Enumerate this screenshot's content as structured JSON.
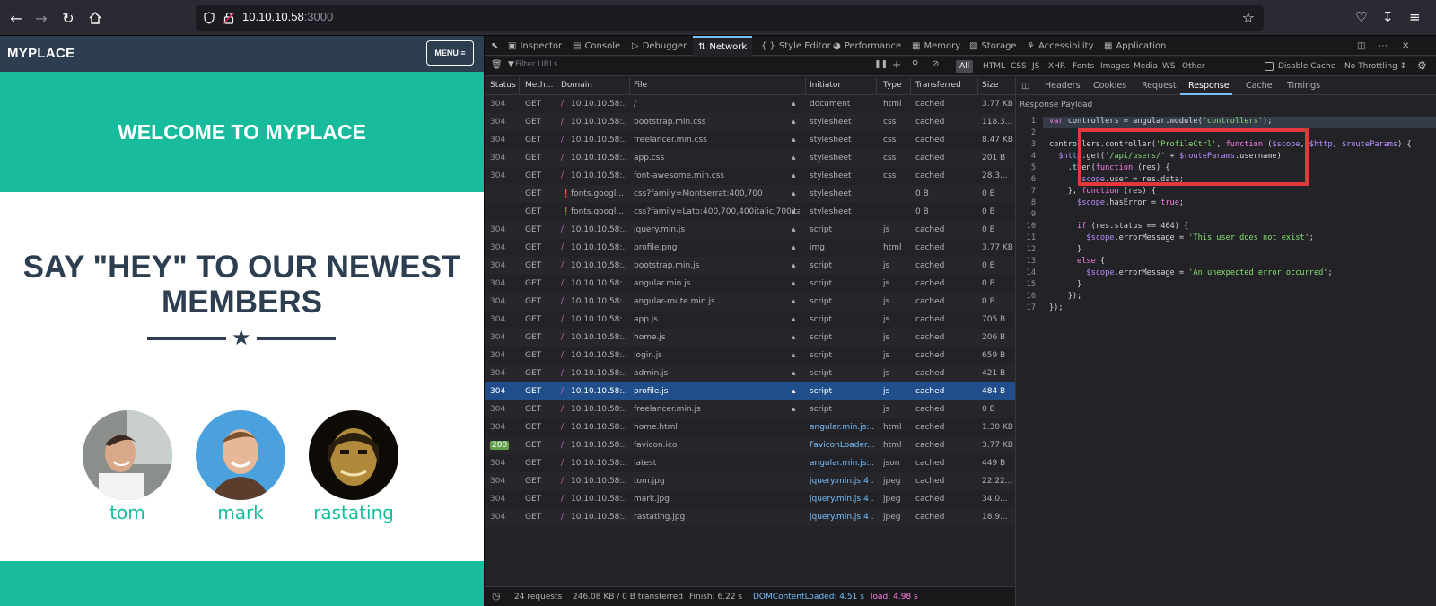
{
  "browser": {
    "url_host": "10.10.10.58",
    "url_port": ":3000"
  },
  "site": {
    "brand": "MYPLACE",
    "menu_label": "MENU ≡",
    "hero_title": "WELCOME TO MYPLACE",
    "members_title": "SAY \"HEY\" TO OUR NEWEST MEMBERS",
    "members": [
      {
        "name": "tom"
      },
      {
        "name": "mark"
      },
      {
        "name": "rastating"
      }
    ]
  },
  "devtools": {
    "tabs": [
      "Inspector",
      "Console",
      "Debugger",
      "Network",
      "Style Editor",
      "Performance",
      "Memory",
      "Storage",
      "Accessibility",
      "Application"
    ],
    "active_tab": "Network",
    "filter_placeholder": "Filter URLs",
    "type_filters": [
      "All",
      "HTML",
      "CSS",
      "JS",
      "XHR",
      "Fonts",
      "Images",
      "Media",
      "WS",
      "Other"
    ],
    "disable_cache": "Disable Cache",
    "throttling": "No Throttling ↕",
    "columns": [
      "Status",
      "Meth…",
      "Domain",
      "File",
      "Initiator",
      "Type",
      "Transferred",
      "Size"
    ],
    "rows": [
      {
        "status": "304",
        "method": "GET",
        "domain": "10.10.10.58:...",
        "file": "/",
        "initiator": "document",
        "type": "html",
        "transferred": "cached",
        "size": "3.77 KB"
      },
      {
        "status": "304",
        "method": "GET",
        "domain": "10.10.10.58:...",
        "file": "bootstrap.min.css",
        "initiator": "stylesheet",
        "type": "css",
        "transferred": "cached",
        "size": "118.3..."
      },
      {
        "status": "304",
        "method": "GET",
        "domain": "10.10.10.58:...",
        "file": "freelancer.min.css",
        "initiator": "stylesheet",
        "type": "css",
        "transferred": "cached",
        "size": "8.47 KB"
      },
      {
        "status": "304",
        "method": "GET",
        "domain": "10.10.10.58:...",
        "file": "app.css",
        "initiator": "stylesheet",
        "type": "css",
        "transferred": "cached",
        "size": "201 B"
      },
      {
        "status": "304",
        "method": "GET",
        "domain": "10.10.10.58:...",
        "file": "font-awesome.min.css",
        "initiator": "stylesheet",
        "type": "css",
        "transferred": "cached",
        "size": "28.3..."
      },
      {
        "status": "",
        "method": "GET",
        "domain": "fonts.googl...",
        "file": "css?family=Montserrat:400,700",
        "initiator": "stylesheet",
        "type": "",
        "transferred": "0 B",
        "size": "0 B"
      },
      {
        "status": "",
        "method": "GET",
        "domain": "fonts.googl...",
        "file": "css?family=Lato:400,700,400italic,700italic",
        "initiator": "stylesheet",
        "type": "",
        "transferred": "0 B",
        "size": "0 B"
      },
      {
        "status": "304",
        "method": "GET",
        "domain": "10.10.10.58:...",
        "file": "jquery.min.js",
        "initiator": "script",
        "type": "js",
        "transferred": "cached",
        "size": "0 B"
      },
      {
        "status": "304",
        "method": "GET",
        "domain": "10.10.10.58:...",
        "file": "profile.png",
        "initiator": "img",
        "type": "html",
        "transferred": "cached",
        "size": "3.77 KB"
      },
      {
        "status": "304",
        "method": "GET",
        "domain": "10.10.10.58:...",
        "file": "bootstrap.min.js",
        "initiator": "script",
        "type": "js",
        "transferred": "cached",
        "size": "0 B"
      },
      {
        "status": "304",
        "method": "GET",
        "domain": "10.10.10.58:...",
        "file": "angular.min.js",
        "initiator": "script",
        "type": "js",
        "transferred": "cached",
        "size": "0 B"
      },
      {
        "status": "304",
        "method": "GET",
        "domain": "10.10.10.58:...",
        "file": "angular-route.min.js",
        "initiator": "script",
        "type": "js",
        "transferred": "cached",
        "size": "0 B"
      },
      {
        "status": "304",
        "method": "GET",
        "domain": "10.10.10.58:...",
        "file": "app.js",
        "initiator": "script",
        "type": "js",
        "transferred": "cached",
        "size": "705 B"
      },
      {
        "status": "304",
        "method": "GET",
        "domain": "10.10.10.58:...",
        "file": "home.js",
        "initiator": "script",
        "type": "js",
        "transferred": "cached",
        "size": "206 B"
      },
      {
        "status": "304",
        "method": "GET",
        "domain": "10.10.10.58:...",
        "file": "login.js",
        "initiator": "script",
        "type": "js",
        "transferred": "cached",
        "size": "659 B"
      },
      {
        "status": "304",
        "method": "GET",
        "domain": "10.10.10.58:...",
        "file": "admin.js",
        "initiator": "script",
        "type": "js",
        "transferred": "cached",
        "size": "421 B"
      },
      {
        "status": "304",
        "method": "GET",
        "domain": "10.10.10.58:...",
        "file": "profile.js",
        "initiator": "script",
        "type": "js",
        "transferred": "cached",
        "size": "484 B"
      },
      {
        "status": "304",
        "method": "GET",
        "domain": "10.10.10.58:...",
        "file": "freelancer.min.js",
        "initiator": "script",
        "type": "js",
        "transferred": "cached",
        "size": "0 B"
      },
      {
        "status": "304",
        "method": "GET",
        "domain": "10.10.10.58:...",
        "file": "home.html",
        "initiator": "angular.min.js:...",
        "type": "html",
        "transferred": "cached",
        "size": "1.30 KB"
      },
      {
        "status": "200",
        "method": "GET",
        "domain": "10.10.10.58:...",
        "file": "favicon.ico",
        "initiator": "FaviconLoader....",
        "type": "html",
        "transferred": "cached",
        "size": "3.77 KB"
      },
      {
        "status": "304",
        "method": "GET",
        "domain": "10.10.10.58:...",
        "file": "latest",
        "initiator": "angular.min.js:...",
        "type": "json",
        "transferred": "cached",
        "size": "449 B"
      },
      {
        "status": "304",
        "method": "GET",
        "domain": "10.10.10.58:...",
        "file": "tom.jpg",
        "initiator": "jquery.min.js:4 ...",
        "type": "jpeg",
        "transferred": "cached",
        "size": "22.22..."
      },
      {
        "status": "304",
        "method": "GET",
        "domain": "10.10.10.58:...",
        "file": "mark.jpg",
        "initiator": "jquery.min.js:4 ...",
        "type": "jpeg",
        "transferred": "cached",
        "size": "34.0..."
      },
      {
        "status": "304",
        "method": "GET",
        "domain": "10.10.10.58:...",
        "file": "rastating.jpg",
        "initiator": "jquery.min.js:4 ...",
        "type": "jpeg",
        "transferred": "cached",
        "size": "18.9..."
      }
    ],
    "status_bar": {
      "requests": "24 requests",
      "transferred": "246.08 KB / 0 B transferred",
      "finish": "Finish: 6.22 s",
      "dcl": "DOMContentLoaded: 4.51 s",
      "load": "load: 4.98 s"
    },
    "response_tabs": [
      "Headers",
      "Cookies",
      "Request",
      "Response",
      "Cache",
      "Timings"
    ],
    "active_response_tab": "Response",
    "payload_label": "Response Payload",
    "code_lines": [
      "var controllers = angular.module('controllers');",
      "",
      "controllers.controller('ProfileCtrl', function ($scope, $http, $routeParams) {",
      "  $http.get('/api/users/' + $routeParams.username)",
      "    .then(function (res) {",
      "      $scope.user = res.data;",
      "    }, function (res) {",
      "      $scope.hasError = true;",
      "",
      "      if (res.status == 404) {",
      "        $scope.errorMessage = 'This user does not exist';",
      "      }",
      "      else {",
      "        $scope.errorMessage = 'An unexpected error occurred';",
      "      }",
      "    });",
      "});"
    ]
  }
}
